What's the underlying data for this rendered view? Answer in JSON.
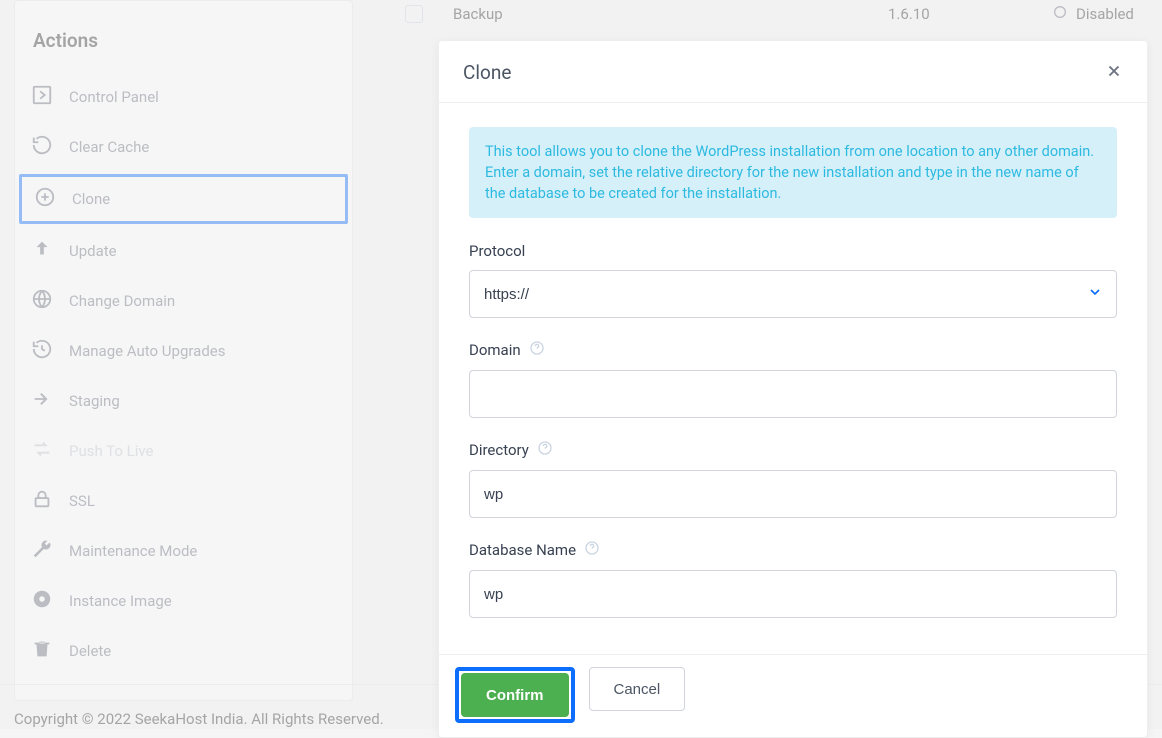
{
  "sidebar": {
    "title": "Actions",
    "items": [
      {
        "label": "Control Panel"
      },
      {
        "label": "Clear Cache"
      },
      {
        "label": "Clone"
      },
      {
        "label": "Update"
      },
      {
        "label": "Change Domain"
      },
      {
        "label": "Manage Auto Upgrades"
      },
      {
        "label": "Staging"
      },
      {
        "label": "Push To Live"
      },
      {
        "label": "SSL"
      },
      {
        "label": "Maintenance Mode"
      },
      {
        "label": "Instance Image"
      },
      {
        "label": "Delete"
      }
    ]
  },
  "content_row": {
    "name": "Backup",
    "version": "1.6.10",
    "status": "Disabled"
  },
  "footer": "Copyright © 2022 SeekaHost India. All Rights Reserved.",
  "modal": {
    "title": "Clone",
    "info": "This tool allows you to clone the WordPress installation from one location to any other domain. Enter a domain, set the relative directory for the new installation and type in the new name of the database to be created for the installation.",
    "fields": {
      "protocol": {
        "label": "Protocol",
        "value": "https://"
      },
      "domain": {
        "label": "Domain",
        "value": ""
      },
      "directory": {
        "label": "Directory",
        "value": "wp"
      },
      "database": {
        "label": "Database Name",
        "value": "wp"
      }
    },
    "buttons": {
      "confirm": "Confirm",
      "cancel": "Cancel"
    }
  }
}
